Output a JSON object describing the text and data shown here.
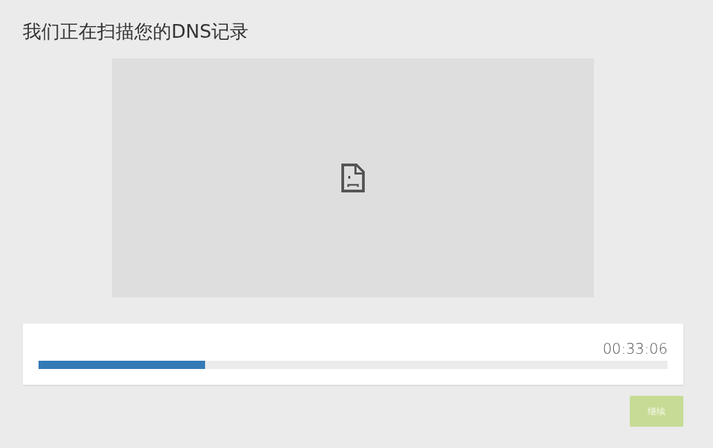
{
  "title": "我们正在扫描您的DNS记录",
  "preview": {
    "kind": "broken_image"
  },
  "progress": {
    "elapsed": "00:33:06",
    "level": 0.265
  },
  "continue_button": {
    "label": "继续",
    "disabled": true
  }
}
